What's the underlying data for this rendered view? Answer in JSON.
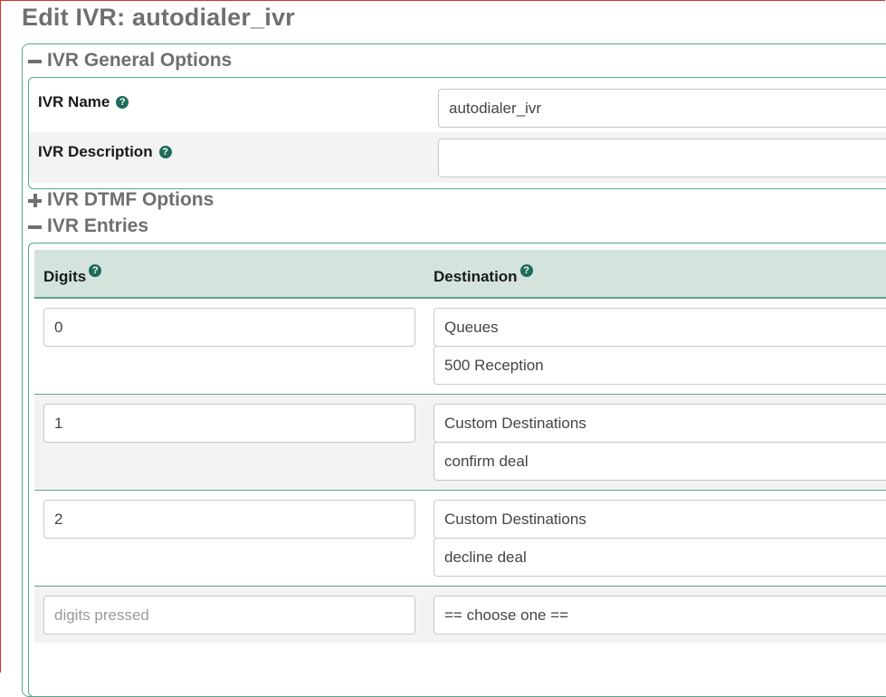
{
  "page": {
    "title": "Edit IVR: autodialer_ivr"
  },
  "sections": {
    "general": {
      "label": "IVR General Options"
    },
    "dtmf": {
      "label": "IVR DTMF Options"
    },
    "entries": {
      "label": "IVR Entries"
    }
  },
  "general": {
    "name_label": "IVR Name",
    "name_value": "autodialer_ivr",
    "description_label": "IVR Description",
    "description_value": ""
  },
  "entries_table": {
    "headers": {
      "digits": "Digits",
      "destination": "Destination"
    },
    "rows": [
      {
        "digits": "0",
        "destination_type": "Queues",
        "destination_target": "500 Reception"
      },
      {
        "digits": "1",
        "destination_type": "Custom Destinations",
        "destination_target": "confirm deal"
      },
      {
        "digits": "2",
        "destination_type": "Custom Destinations",
        "destination_target": "decline deal"
      }
    ],
    "new_row": {
      "digits_placeholder": "digits pressed",
      "destination_type": "== choose one =="
    }
  },
  "icons": {
    "help": "question-circle-icon",
    "collapse": "minus-icon",
    "expand": "plus-icon"
  },
  "colors": {
    "accent_border": "#5aa58a",
    "header_bg": "#d4e4dd",
    "help_icon": "#1e6b5b"
  }
}
